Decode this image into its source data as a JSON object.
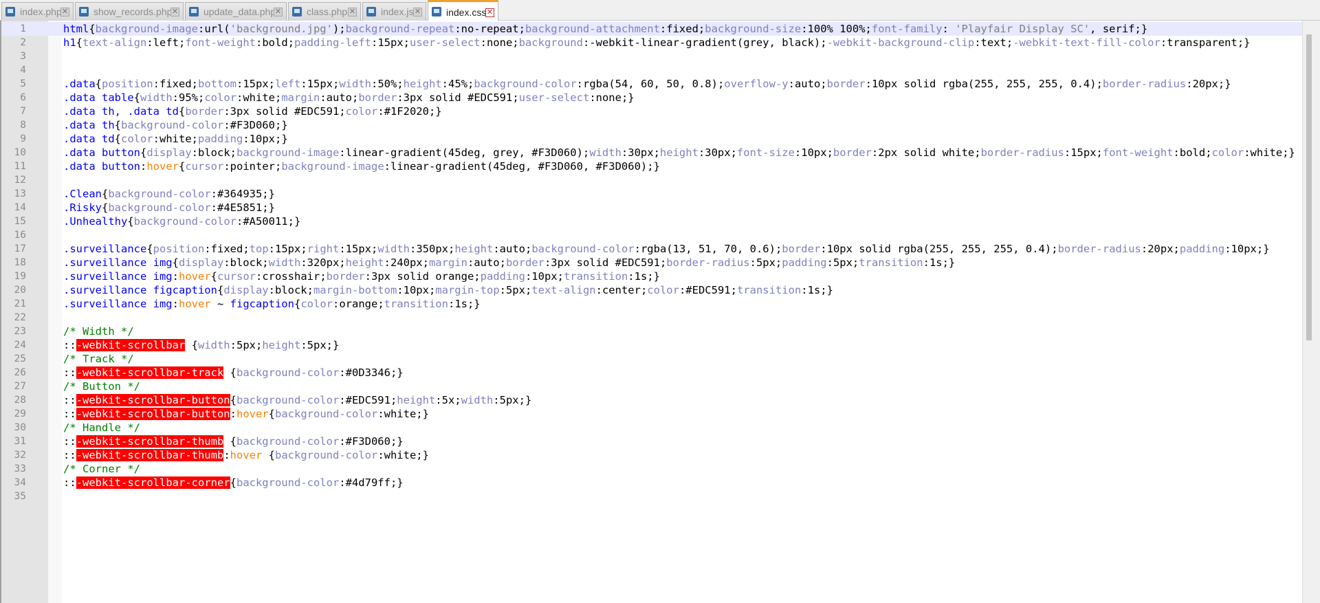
{
  "tabs": [
    {
      "label": "index.php",
      "active": false,
      "modified": false
    },
    {
      "label": "show_records.php",
      "active": false,
      "modified": false
    },
    {
      "label": "update_data.php",
      "active": false,
      "modified": false
    },
    {
      "label": "class.php",
      "active": false,
      "modified": false
    },
    {
      "label": "index.js",
      "active": false,
      "modified": false
    },
    {
      "label": "index.css",
      "active": true,
      "modified": true
    }
  ],
  "editor": {
    "file": "index.css",
    "current_line": 1,
    "lines": [
      [
        [
          "sel",
          "html"
        ],
        [
          "val",
          "{"
        ],
        [
          "prop",
          "background-image"
        ],
        [
          "val",
          ":url("
        ],
        [
          "str",
          "'background.jpg'"
        ],
        [
          "val",
          ");"
        ],
        [
          "prop",
          "background-repeat"
        ],
        [
          "val",
          ":no-repeat;"
        ],
        [
          "prop",
          "background-attachment"
        ],
        [
          "val",
          ":fixed;"
        ],
        [
          "prop",
          "background-size"
        ],
        [
          "val",
          ":100% 100%;"
        ],
        [
          "prop",
          "font-family"
        ],
        [
          "val",
          ": "
        ],
        [
          "str",
          "'Playfair Display SC'"
        ],
        [
          "val",
          ", serif;}"
        ]
      ],
      [
        [
          "sel",
          "h1"
        ],
        [
          "val",
          "{"
        ],
        [
          "prop",
          "text-align"
        ],
        [
          "val",
          ":left;"
        ],
        [
          "prop",
          "font-weight"
        ],
        [
          "val",
          ":bold;"
        ],
        [
          "prop",
          "padding-left"
        ],
        [
          "val",
          ":15px;"
        ],
        [
          "prop",
          "user-select"
        ],
        [
          "val",
          ":none;"
        ],
        [
          "prop",
          "background"
        ],
        [
          "val",
          ":-webkit-linear-gradient(grey, black);"
        ],
        [
          "prop",
          "-webkit-background-clip"
        ],
        [
          "val",
          ":text;"
        ],
        [
          "prop",
          "-webkit-text-fill-color"
        ],
        [
          "val",
          ":transparent;}"
        ]
      ],
      [],
      [],
      [
        [
          "sel",
          ".data"
        ],
        [
          "val",
          "{"
        ],
        [
          "prop",
          "position"
        ],
        [
          "val",
          ":fixed;"
        ],
        [
          "prop",
          "bottom"
        ],
        [
          "val",
          ":15px;"
        ],
        [
          "prop",
          "left"
        ],
        [
          "val",
          ":15px;"
        ],
        [
          "prop",
          "width"
        ],
        [
          "val",
          ":50%;"
        ],
        [
          "prop",
          "height"
        ],
        [
          "val",
          ":45%;"
        ],
        [
          "prop",
          "background-color"
        ],
        [
          "val",
          ":rgba(54, 60, 50, 0.8);"
        ],
        [
          "prop",
          "overflow-y"
        ],
        [
          "val",
          ":auto;"
        ],
        [
          "prop",
          "border"
        ],
        [
          "val",
          ":10px solid rgba(255, 255, 255, 0.4);"
        ],
        [
          "prop",
          "border-radius"
        ],
        [
          "val",
          ":20px;}"
        ]
      ],
      [
        [
          "sel",
          ".data table"
        ],
        [
          "val",
          "{"
        ],
        [
          "prop",
          "width"
        ],
        [
          "val",
          ":95%;"
        ],
        [
          "prop",
          "color"
        ],
        [
          "val",
          ":white;"
        ],
        [
          "prop",
          "margin"
        ],
        [
          "val",
          ":auto;"
        ],
        [
          "prop",
          "border"
        ],
        [
          "val",
          ":3px solid #EDC591;"
        ],
        [
          "prop",
          "user-select"
        ],
        [
          "val",
          ":none;}"
        ]
      ],
      [
        [
          "sel",
          ".data th, .data td"
        ],
        [
          "val",
          "{"
        ],
        [
          "prop",
          "border"
        ],
        [
          "val",
          ":3px solid #EDC591;"
        ],
        [
          "prop",
          "color"
        ],
        [
          "val",
          ":#1F2020;}"
        ]
      ],
      [
        [
          "sel",
          ".data th"
        ],
        [
          "val",
          "{"
        ],
        [
          "prop",
          "background-color"
        ],
        [
          "val",
          ":#F3D060;}"
        ]
      ],
      [
        [
          "sel",
          ".data td"
        ],
        [
          "val",
          "{"
        ],
        [
          "prop",
          "color"
        ],
        [
          "val",
          ":white;"
        ],
        [
          "prop",
          "padding"
        ],
        [
          "val",
          ":10px;}"
        ]
      ],
      [
        [
          "sel",
          ".data button"
        ],
        [
          "val",
          "{"
        ],
        [
          "prop",
          "display"
        ],
        [
          "val",
          ":block;"
        ],
        [
          "prop",
          "background-image"
        ],
        [
          "val",
          ":linear-gradient(45deg, grey, #F3D060);"
        ],
        [
          "prop",
          "width"
        ],
        [
          "val",
          ":30px;"
        ],
        [
          "prop",
          "height"
        ],
        [
          "val",
          ":30px;"
        ],
        [
          "prop",
          "font-size"
        ],
        [
          "val",
          ":10px;"
        ],
        [
          "prop",
          "border"
        ],
        [
          "val",
          ":2px solid white;"
        ],
        [
          "prop",
          "border-radius"
        ],
        [
          "val",
          ":15px;"
        ],
        [
          "prop",
          "font-weight"
        ],
        [
          "val",
          ":bold;"
        ],
        [
          "prop",
          "color"
        ],
        [
          "val",
          ":white;}"
        ]
      ],
      [
        [
          "sel",
          ".data button"
        ],
        [
          "val",
          ":"
        ],
        [
          "pseudo",
          "hover"
        ],
        [
          "val",
          "{"
        ],
        [
          "prop",
          "cursor"
        ],
        [
          "val",
          ":pointer;"
        ],
        [
          "prop",
          "background-image"
        ],
        [
          "val",
          ":linear-gradient(45deg, #F3D060, #F3D060);}"
        ]
      ],
      [],
      [
        [
          "sel",
          ".Clean"
        ],
        [
          "val",
          "{"
        ],
        [
          "prop",
          "background-color"
        ],
        [
          "val",
          ":#364935;}"
        ]
      ],
      [
        [
          "sel",
          ".Risky"
        ],
        [
          "val",
          "{"
        ],
        [
          "prop",
          "background-color"
        ],
        [
          "val",
          ":#4E5851;}"
        ]
      ],
      [
        [
          "sel",
          ".Unhealthy"
        ],
        [
          "val",
          "{"
        ],
        [
          "prop",
          "background-color"
        ],
        [
          "val",
          ":#A50011;}"
        ]
      ],
      [],
      [
        [
          "sel",
          ".surveillance"
        ],
        [
          "val",
          "{"
        ],
        [
          "prop",
          "position"
        ],
        [
          "val",
          ":fixed;"
        ],
        [
          "prop",
          "top"
        ],
        [
          "val",
          ":15px;"
        ],
        [
          "prop",
          "right"
        ],
        [
          "val",
          ":15px;"
        ],
        [
          "prop",
          "width"
        ],
        [
          "val",
          ":350px;"
        ],
        [
          "prop",
          "height"
        ],
        [
          "val",
          ":auto;"
        ],
        [
          "prop",
          "background-color"
        ],
        [
          "val",
          ":rgba(13, 51, 70, 0.6);"
        ],
        [
          "prop",
          "border"
        ],
        [
          "val",
          ":10px solid rgba(255, 255, 255, 0.4);"
        ],
        [
          "prop",
          "border-radius"
        ],
        [
          "val",
          ":20px;"
        ],
        [
          "prop",
          "padding"
        ],
        [
          "val",
          ":10px;}"
        ]
      ],
      [
        [
          "sel",
          ".surveillance img"
        ],
        [
          "val",
          "{"
        ],
        [
          "prop",
          "display"
        ],
        [
          "val",
          ":block;"
        ],
        [
          "prop",
          "width"
        ],
        [
          "val",
          ":320px;"
        ],
        [
          "prop",
          "height"
        ],
        [
          "val",
          ":240px;"
        ],
        [
          "prop",
          "margin"
        ],
        [
          "val",
          ":auto;"
        ],
        [
          "prop",
          "border"
        ],
        [
          "val",
          ":3px solid #EDC591;"
        ],
        [
          "prop",
          "border-radius"
        ],
        [
          "val",
          ":5px;"
        ],
        [
          "prop",
          "padding"
        ],
        [
          "val",
          ":5px;"
        ],
        [
          "prop",
          "transition"
        ],
        [
          "val",
          ":1s;}"
        ]
      ],
      [
        [
          "sel",
          ".surveillance img"
        ],
        [
          "val",
          ":"
        ],
        [
          "pseudo",
          "hover"
        ],
        [
          "val",
          "{"
        ],
        [
          "prop",
          "cursor"
        ],
        [
          "val",
          ":crosshair;"
        ],
        [
          "prop",
          "border"
        ],
        [
          "val",
          ":3px solid orange;"
        ],
        [
          "prop",
          "padding"
        ],
        [
          "val",
          ":10px;"
        ],
        [
          "prop",
          "transition"
        ],
        [
          "val",
          ":1s;}"
        ]
      ],
      [
        [
          "sel",
          ".surveillance figcaption"
        ],
        [
          "val",
          "{"
        ],
        [
          "prop",
          "display"
        ],
        [
          "val",
          ":block;"
        ],
        [
          "prop",
          "margin-bottom"
        ],
        [
          "val",
          ":10px;"
        ],
        [
          "prop",
          "margin-top"
        ],
        [
          "val",
          ":5px;"
        ],
        [
          "prop",
          "text-align"
        ],
        [
          "val",
          ":center;"
        ],
        [
          "prop",
          "color"
        ],
        [
          "val",
          ":#EDC591;"
        ],
        [
          "prop",
          "transition"
        ],
        [
          "val",
          ":1s;}"
        ]
      ],
      [
        [
          "sel",
          ".surveillance img"
        ],
        [
          "val",
          ":"
        ],
        [
          "pseudo",
          "hover"
        ],
        [
          "val",
          " ~ "
        ],
        [
          "sel",
          "figcaption"
        ],
        [
          "val",
          "{"
        ],
        [
          "prop",
          "color"
        ],
        [
          "val",
          ":orange;"
        ],
        [
          "prop",
          "transition"
        ],
        [
          "val",
          ":1s;}"
        ]
      ],
      [],
      [
        [
          "cmt",
          "/* Width */"
        ]
      ],
      [
        [
          "val",
          "::"
        ],
        [
          "err",
          "-webkit-scrollbar"
        ],
        [
          "val",
          " {"
        ],
        [
          "prop",
          "width"
        ],
        [
          "val",
          ":5px;"
        ],
        [
          "prop",
          "height"
        ],
        [
          "val",
          ":5px;}"
        ]
      ],
      [
        [
          "cmt",
          "/* Track */"
        ]
      ],
      [
        [
          "val",
          "::"
        ],
        [
          "err",
          "-webkit-scrollbar-track"
        ],
        [
          "val",
          " {"
        ],
        [
          "prop",
          "background-color"
        ],
        [
          "val",
          ":#0D3346;}"
        ]
      ],
      [
        [
          "cmt",
          "/* Button */"
        ]
      ],
      [
        [
          "val",
          "::"
        ],
        [
          "err",
          "-webkit-scrollbar-button"
        ],
        [
          "val",
          "{"
        ],
        [
          "prop",
          "background-color"
        ],
        [
          "val",
          ":#EDC591;"
        ],
        [
          "prop",
          "height"
        ],
        [
          "val",
          ":5x;"
        ],
        [
          "prop",
          "width"
        ],
        [
          "val",
          ":5px;}"
        ]
      ],
      [
        [
          "val",
          "::"
        ],
        [
          "err",
          "-webkit-scrollbar-button"
        ],
        [
          "val",
          ":"
        ],
        [
          "pseudo",
          "hover"
        ],
        [
          "val",
          "{"
        ],
        [
          "prop",
          "background-color"
        ],
        [
          "val",
          ":white;}"
        ]
      ],
      [
        [
          "cmt",
          "/* Handle */"
        ]
      ],
      [
        [
          "val",
          "::"
        ],
        [
          "err",
          "-webkit-scrollbar-thumb"
        ],
        [
          "val",
          " {"
        ],
        [
          "prop",
          "background-color"
        ],
        [
          "val",
          ":#F3D060;}"
        ]
      ],
      [
        [
          "val",
          "::"
        ],
        [
          "err",
          "-webkit-scrollbar-thumb"
        ],
        [
          "val",
          ":"
        ],
        [
          "pseudo",
          "hover"
        ],
        [
          "val",
          " {"
        ],
        [
          "prop",
          "background-color"
        ],
        [
          "val",
          ":white;}"
        ]
      ],
      [
        [
          "cmt",
          "/* Corner */"
        ]
      ],
      [
        [
          "val",
          "::"
        ],
        [
          "err",
          "-webkit-scrollbar-corner"
        ],
        [
          "val",
          "{"
        ],
        [
          "prop",
          "background-color"
        ],
        [
          "val",
          ":#4d79ff;}"
        ]
      ],
      []
    ]
  },
  "colors": {
    "selector": "#0000ff",
    "property": "#8080c0",
    "pseudo": "#ff8000",
    "comment": "#008000",
    "string": "#808080",
    "error_bg": "#ff0000",
    "active_tab_accent": "#f0a030"
  }
}
